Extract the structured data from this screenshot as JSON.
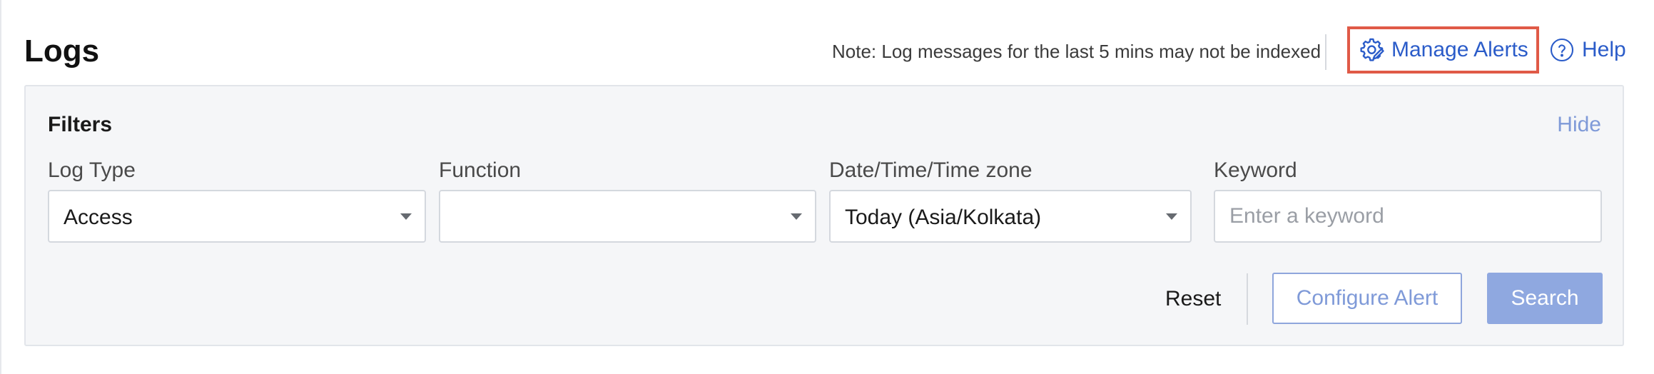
{
  "header": {
    "title": "Logs",
    "note": "Note: Log messages for the last 5 mins may not be indexed",
    "manage_alerts_label": "Manage Alerts",
    "help_label": "Help"
  },
  "filters": {
    "title": "Filters",
    "hide_label": "Hide",
    "log_type": {
      "label": "Log Type",
      "value": "Access"
    },
    "function": {
      "label": "Function",
      "value": ""
    },
    "datetime": {
      "label": "Date/Time/Time zone",
      "value": "Today (Asia/Kolkata)"
    },
    "keyword": {
      "label": "Keyword",
      "value": "",
      "placeholder": "Enter a keyword"
    }
  },
  "actions": {
    "reset_label": "Reset",
    "configure_alert_label": "Configure Alert",
    "search_label": "Search"
  },
  "icons": {
    "manage_alerts": "gear-pencil-icon",
    "help": "question-circle-icon",
    "dropdown": "caret-down-icon"
  },
  "colors": {
    "link_blue": "#2b5cc9",
    "muted_blue": "#7f9ad8",
    "highlight_red": "#e05a47",
    "search_button_bg": "#8fa8e0"
  }
}
